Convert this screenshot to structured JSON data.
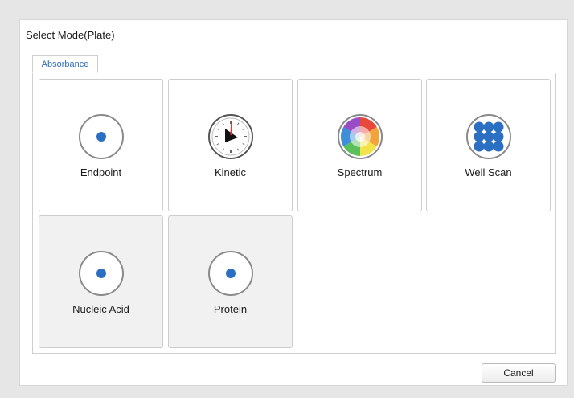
{
  "dialog": {
    "title": "Select Mode(Plate)",
    "cancel_label": "Cancel"
  },
  "tabs": [
    {
      "label": "Absorbance",
      "selected": true
    }
  ],
  "modes": [
    {
      "label": "Endpoint",
      "icon": "endpoint-dot-icon"
    },
    {
      "label": "Kinetic",
      "icon": "clock-icon"
    },
    {
      "label": "Spectrum",
      "icon": "color-wheel-icon"
    },
    {
      "label": "Well Scan",
      "icon": "well-grid-icon"
    },
    {
      "label": "Nucleic Acid",
      "icon": "nucleic-acid-dot-icon"
    },
    {
      "label": "Protein",
      "icon": "protein-dot-icon"
    }
  ],
  "colors": {
    "accent_blue": "#2a6fc2",
    "tab_text": "#2f6fb7",
    "clock_hand": "#d03a2f"
  }
}
